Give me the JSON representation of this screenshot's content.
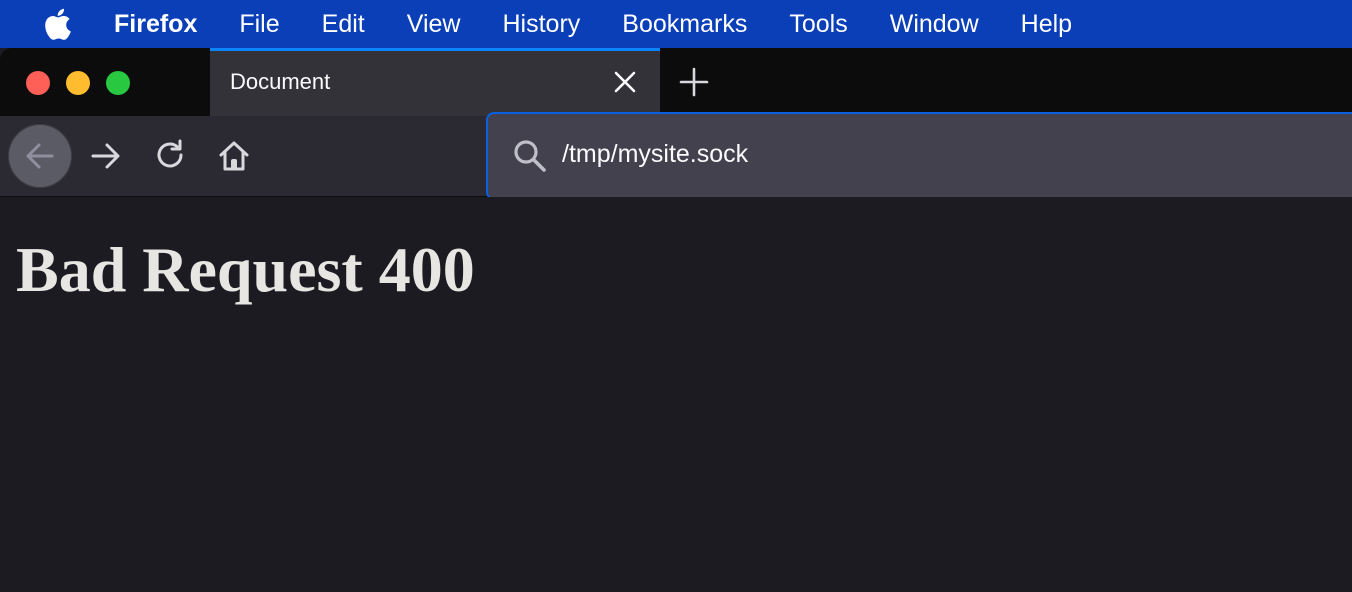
{
  "menubar": {
    "apple_icon": "apple-logo-icon",
    "items": [
      "Firefox",
      "File",
      "Edit",
      "View",
      "History",
      "Bookmarks",
      "Tools",
      "Window",
      "Help"
    ]
  },
  "window": {
    "traffic_lights": [
      "close",
      "minimize",
      "zoom"
    ],
    "tab": {
      "title": "Document",
      "close_icon": "close-icon"
    },
    "new_tab_icon": "plus-icon"
  },
  "toolbar": {
    "back_icon": "arrow-left-icon",
    "forward_icon": "arrow-right-icon",
    "reload_icon": "reload-icon",
    "home_icon": "home-icon"
  },
  "urlbar": {
    "search_icon": "search-icon",
    "value": "/tmp/mysite.sock"
  },
  "page": {
    "heading": "Bad Request 400"
  },
  "colors": {
    "menubar_bg": "#0a3fb8",
    "accent": "#0a84ff",
    "page_bg": "#1c1b22"
  }
}
